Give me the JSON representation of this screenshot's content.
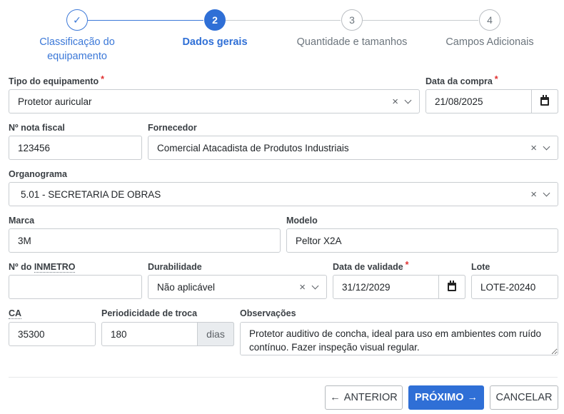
{
  "stepper": {
    "steps": [
      {
        "number": "✓",
        "label": "Classificação do equipamento",
        "state": "done"
      },
      {
        "number": "2",
        "label": "Dados gerais",
        "state": "active"
      },
      {
        "number": "3",
        "label": "Quantidade e tamanhos",
        "state": "todo"
      },
      {
        "number": "4",
        "label": "Campos Adicionais",
        "state": "todo"
      }
    ]
  },
  "form": {
    "tipo_equipamento": {
      "label": "Tipo do equipamento",
      "required": "*",
      "value": "Protetor auricular"
    },
    "data_compra": {
      "label": "Data da compra",
      "required": "*",
      "value": "21/08/2025"
    },
    "nota_fiscal": {
      "label": "Nº nota fiscal",
      "value": "123456"
    },
    "fornecedor": {
      "label": "Fornecedor",
      "value": "Comercial Atacadista de Produtos Industriais"
    },
    "organograma": {
      "label": "Organograma",
      "value": "5.01 - SECRETARIA DE OBRAS"
    },
    "marca": {
      "label": "Marca",
      "value": "3M"
    },
    "modelo": {
      "label": "Modelo",
      "value": "Peltor X2A"
    },
    "inmetro": {
      "label_prefix": "Nº do ",
      "label_dotted": "INMETRO",
      "value": ""
    },
    "durabilidade": {
      "label": "Durabilidade",
      "value": "Não aplicável"
    },
    "data_validade": {
      "label": "Data de validade",
      "required": "*",
      "value": "31/12/2029"
    },
    "lote": {
      "label": "Lote",
      "value": "LOTE-20240"
    },
    "ca": {
      "label": "CA",
      "value": "35300"
    },
    "periodicidade": {
      "label": "Periodicidade de troca",
      "value": "180",
      "addon": "dias"
    },
    "observacoes": {
      "label": "Observações",
      "value": "Protetor auditivo de concha, ideal para uso em ambientes com ruído contínuo. Fazer inspeção visual regular."
    }
  },
  "footer": {
    "anterior_label": "ANTERIOR",
    "anterior_icon": "←",
    "proximo_label": "PRÓXIMO",
    "proximo_icon": "→",
    "cancelar_label": "CANCELAR"
  },
  "colors": {
    "primary": "#2f6fd6",
    "required": "#e03131"
  },
  "icons": {
    "clear": "×",
    "check": "✓"
  }
}
